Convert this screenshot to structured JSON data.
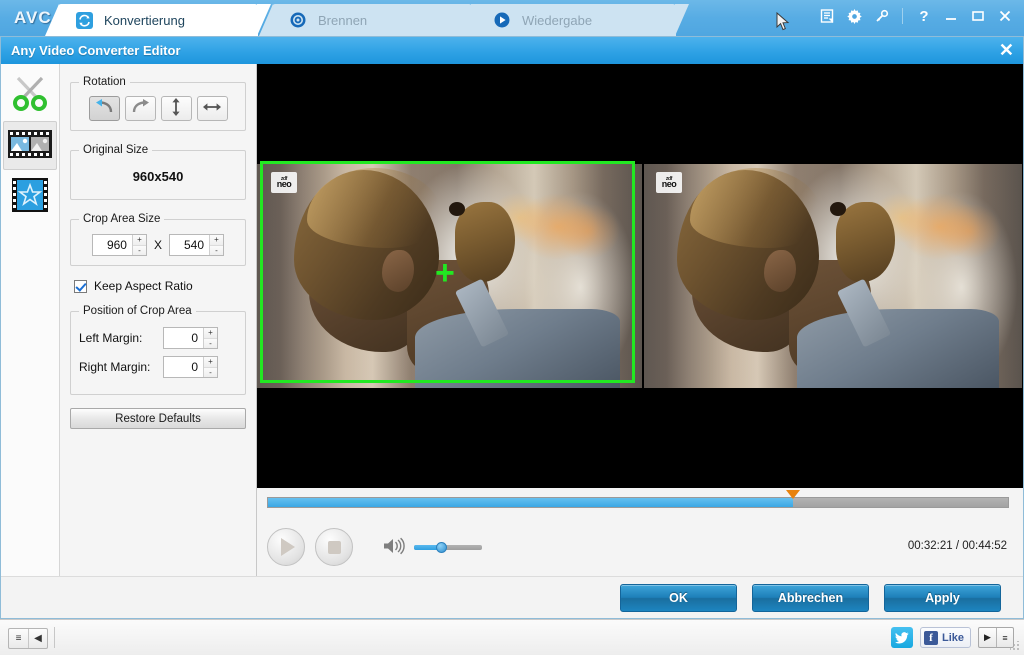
{
  "app": {
    "logo": "AVC",
    "tabs": [
      {
        "label": "Konvertierung",
        "icon": "convert-icon",
        "active": true
      },
      {
        "label": "Brennen",
        "icon": "burn-disc-icon",
        "active": false
      },
      {
        "label": "Wiedergabe",
        "icon": "play-circle-icon",
        "active": false
      }
    ],
    "titlebar_icons": [
      "list-form-icon",
      "gear-icon",
      "key-icon",
      "help-icon",
      "minimize-icon",
      "maximize-icon",
      "close-icon"
    ],
    "help_glyph": "?",
    "minimize_glyph": "—",
    "close_glyph": "✕"
  },
  "editor": {
    "title": "Any Video Converter Editor",
    "close_glyph": "✕",
    "rail": [
      {
        "name": "clip-tool",
        "icon": "scissors-icon",
        "selected": false
      },
      {
        "name": "crop-tool",
        "icon": "film-crop-icon",
        "selected": true
      },
      {
        "name": "effects-tool",
        "icon": "film-star-icon",
        "selected": false
      }
    ],
    "rotation": {
      "legend": "Rotation",
      "buttons": [
        {
          "name": "rotate-left",
          "icon": "rotate-left-icon",
          "active": true
        },
        {
          "name": "rotate-right",
          "icon": "rotate-right-icon",
          "active": false
        },
        {
          "name": "flip-vertical",
          "icon": "flip-vertical-icon",
          "active": false
        },
        {
          "name": "flip-horizontal",
          "icon": "flip-horizontal-icon",
          "active": false
        }
      ]
    },
    "original_size": {
      "legend": "Original Size",
      "value": "960x540"
    },
    "crop_area_size": {
      "legend": "Crop Area Size",
      "width": "960",
      "height": "540",
      "separator": "X",
      "plus": "+",
      "minus": "-"
    },
    "keep_aspect_ratio": {
      "label": "Keep Aspect Ratio",
      "checked": true
    },
    "position_of_crop_area": {
      "legend": "Position of Crop Area",
      "left_margin_label": "Left Margin:",
      "left_margin_value": "0",
      "right_margin_label": "Right Margin:",
      "right_margin_value": "0"
    },
    "restore_defaults_label": "Restore Defaults",
    "footer": {
      "ok": "OK",
      "cancel": "Abbrechen",
      "apply": "Apply"
    }
  },
  "player": {
    "seek_percent": 71,
    "marker_percent": 71,
    "volume_percent": 40,
    "timecode": "00:32:21 / 00:44:52",
    "play_icon": "play-icon",
    "stop_icon": "stop-icon",
    "volume_icon": "speaker-icon"
  },
  "preview": {
    "watermark_top": "zdf",
    "watermark_bottom": "neo",
    "crop_cross": "+"
  },
  "status_bar": {
    "left_buttons": [
      "menu-icon",
      "collapse-left-icon"
    ],
    "left_glyphs": [
      "≡",
      "◀"
    ],
    "twitter_glyph": "t",
    "facebook_f": "f",
    "facebook_like": "Like",
    "right_glyphs": [
      "▶",
      "≡"
    ]
  },
  "colors": {
    "accent_blue": "#3ba7e4",
    "title_blue": "#2fa2e5",
    "crop_green": "#22e822",
    "marker_orange": "#e8820d",
    "button_blue": "#1d7fb8"
  }
}
